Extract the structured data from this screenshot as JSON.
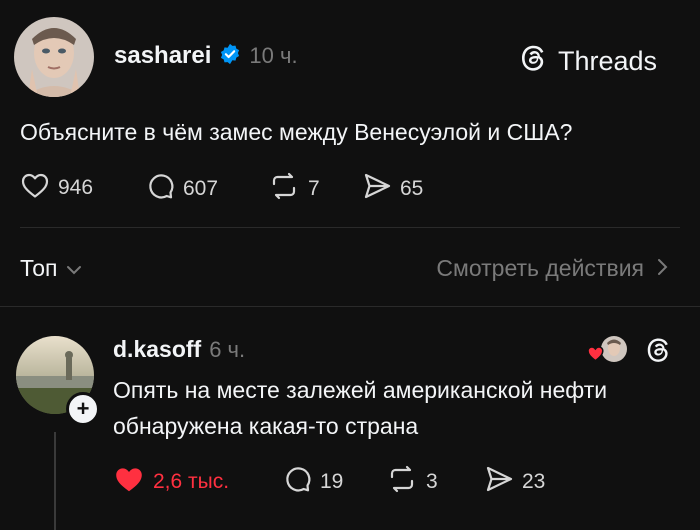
{
  "post": {
    "username": "sasharei",
    "time": "10 ч.",
    "text": "Объясните в чём замес между Венесуэлой и США?",
    "likes": "946",
    "comments": "607",
    "reposts": "7",
    "shares": "65"
  },
  "brand": {
    "name": "Threads"
  },
  "sort": {
    "label": "Топ",
    "activity_link": "Смотреть действия"
  },
  "reply": {
    "username": "d.kasoff",
    "time": "6 ч.",
    "text_line1": "Опять на месте залежей американской нефти",
    "text_line2": "обнаружена какая-то страна",
    "likes": "2,6 тыс.",
    "comments": "19",
    "reposts": "3",
    "shares": "23"
  },
  "colors": {
    "background": "#101010",
    "liked": "#ff3040",
    "verified": "#0095f6",
    "muted": "#7a7a7a"
  }
}
